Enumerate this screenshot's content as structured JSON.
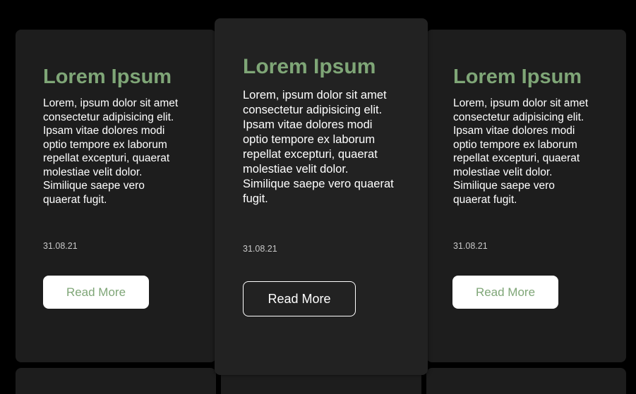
{
  "cards": [
    {
      "title": "Lorem Ipsum",
      "body": "Lorem, ipsum dolor sit amet consectetur adipisicing elit. Ipsam vitae dolores modi optio tempore ex laborum repellat excepturi, quaerat molestiae velit dolor. Similique saepe vero quaerat fugit.",
      "date": "31.08.21",
      "button_label": "Read More"
    },
    {
      "title": "Lorem Ipsum",
      "body": "Lorem, ipsum dolor sit amet consectetur adipisicing elit. Ipsam vitae dolores modi optio tempore ex laborum repellat excepturi, quaerat molestiae velit dolor. Similique saepe vero quaerat fugit.",
      "date": "31.08.21",
      "button_label": "Read More"
    },
    {
      "title": "Lorem Ipsum",
      "body": "Lorem, ipsum dolor sit amet consectetur adipisicing elit. Ipsam vitae dolores modi optio tempore ex laborum repellat excepturi, quaerat molestiae velit dolor. Similique saepe vero quaerat fugit.",
      "date": "31.08.21",
      "button_label": "Read More"
    }
  ],
  "colors": {
    "page_background": "#000000",
    "card_background": "#1d1d1d",
    "card_hover_background": "#222222",
    "title_accent": "#7fa677",
    "text": "#ffffff",
    "date_text": "#c8c8c8",
    "button_light": "#ffffff"
  }
}
